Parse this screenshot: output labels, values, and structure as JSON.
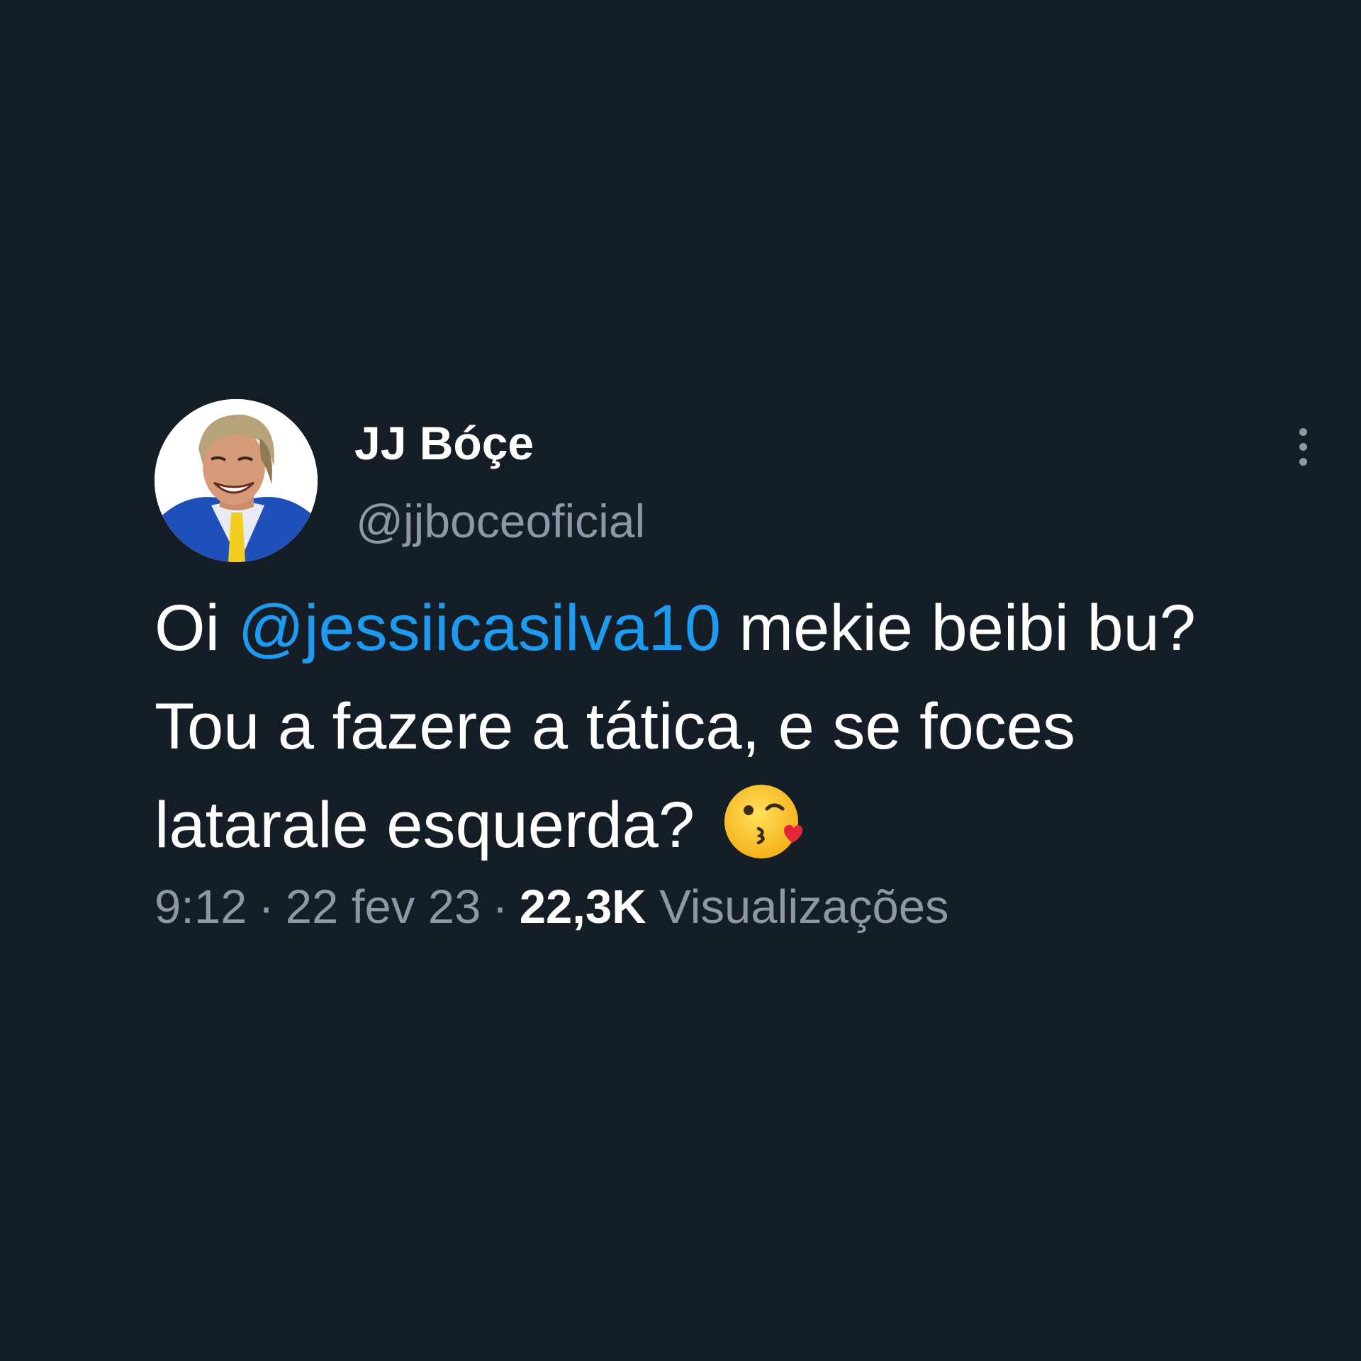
{
  "tweet": {
    "author": {
      "display_name": "JJ Bóçe",
      "handle": "@jjboceoficial",
      "avatar_icon": "profile-photo"
    },
    "more_icon": "more-vertical-icon",
    "text": {
      "prefix": "Oi ",
      "mention": "@jessiicasilva10",
      "rest": " mekie beibi bu? Tou a fazere a tática, e se foces latarale esquerda? ",
      "emoji": "😘"
    },
    "meta": {
      "time": "9:12",
      "separator": "·",
      "date": "22 fev 23",
      "views_count": "22,3K",
      "views_label": "Visualizações"
    }
  },
  "colors": {
    "background": "#151d27",
    "primary_text": "#ffffff",
    "secondary_text": "#8b98a5",
    "mention": "#1d9bf0"
  }
}
